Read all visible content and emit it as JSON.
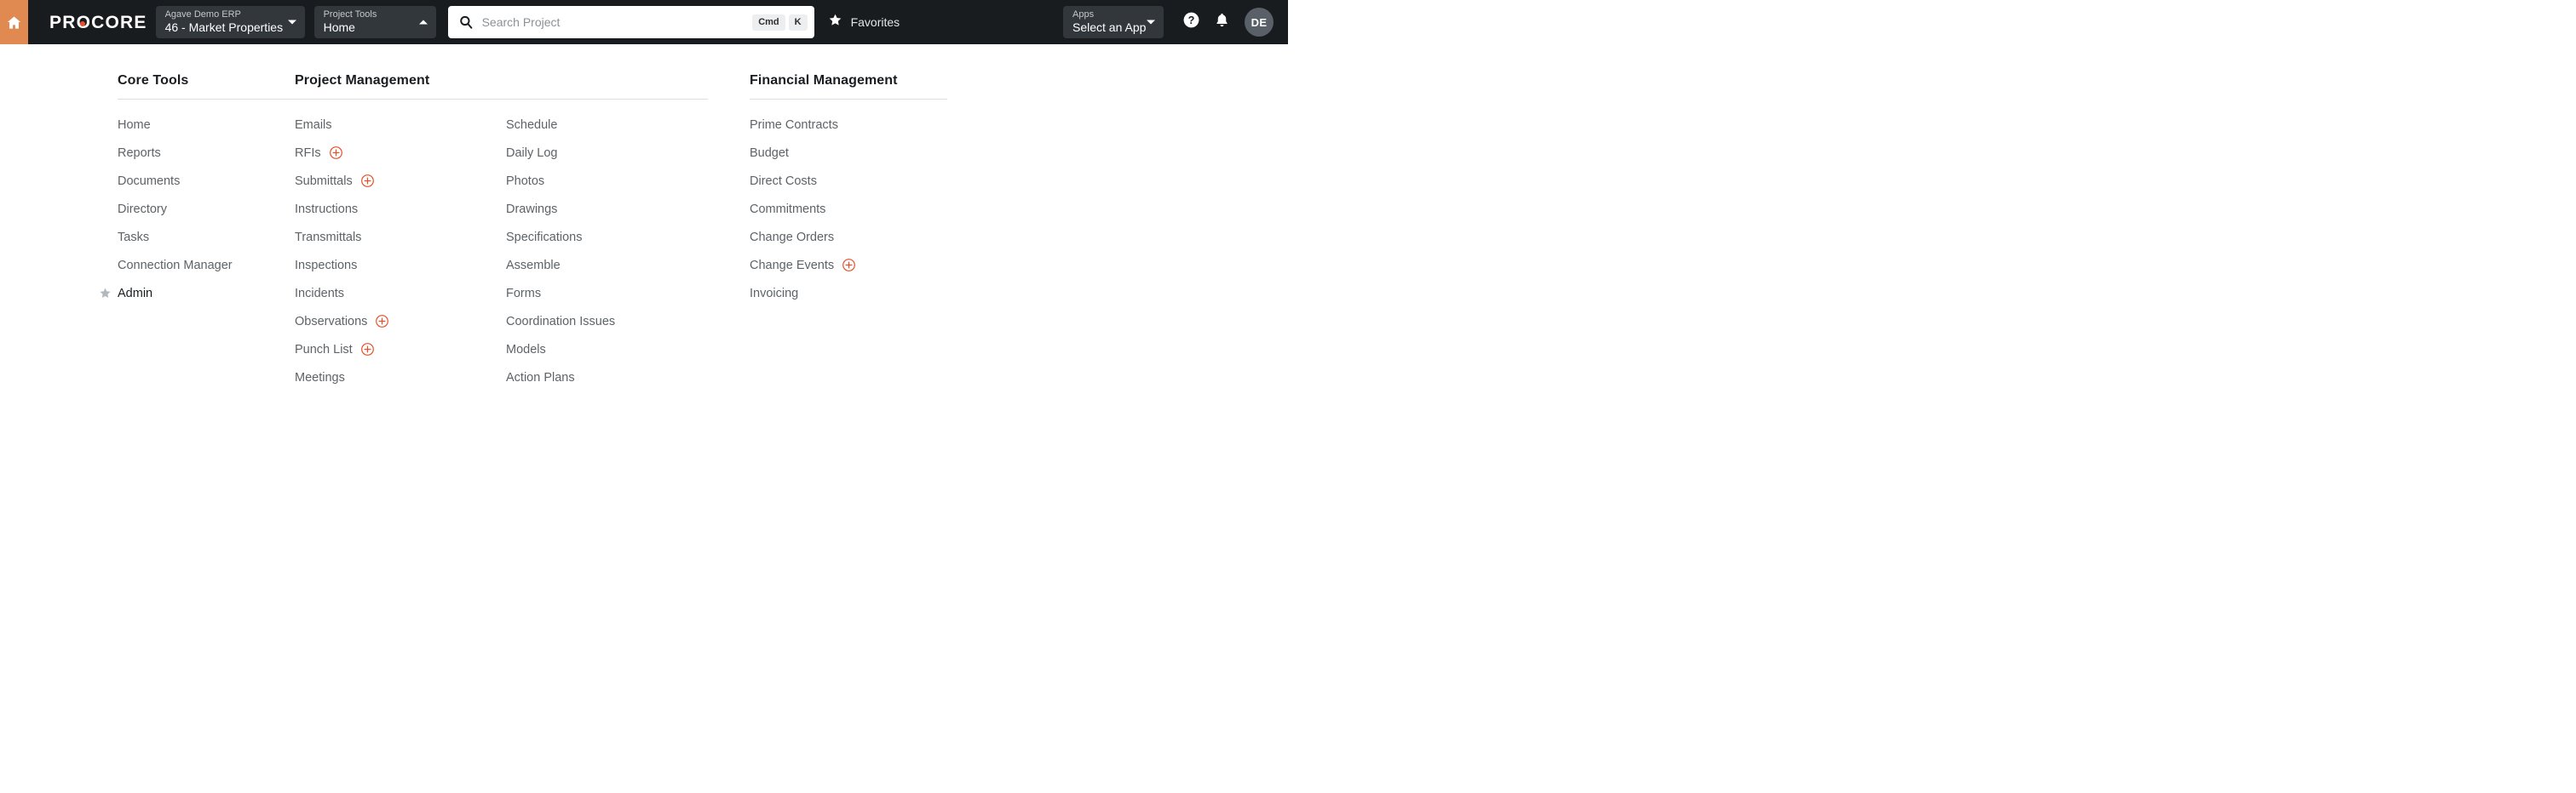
{
  "colors": {
    "header_bg": "#191C1F",
    "home_orange": "#E08A52",
    "accent_orange": "#E8502A",
    "select_bg": "#32373C",
    "text_muted": "#5E6367",
    "text_dark": "#1A1D20"
  },
  "header": {
    "home_icon": "home-icon",
    "brand": "PROCORE",
    "project_select": {
      "label": "Agave Demo ERP",
      "value": "46 - Market Properties",
      "caret": "chevron-down-icon"
    },
    "tools_select": {
      "label": "Project Tools",
      "value": "Home",
      "caret": "chevron-up-icon"
    },
    "search": {
      "icon": "search-icon",
      "placeholder": "Search Project",
      "value": "",
      "shortcut_modifier": "Cmd",
      "shortcut_key": "K"
    },
    "favorites": {
      "icon": "star-icon",
      "label": "Favorites"
    },
    "apps_select": {
      "label": "Apps",
      "value": "Select an App",
      "caret": "chevron-down-icon"
    },
    "help_icon": "help-circle-icon",
    "notifications_icon": "bell-icon",
    "avatar_initials": "DE"
  },
  "menu": {
    "groups": [
      {
        "title": "Core Tools",
        "columns": [
          {
            "items": [
              {
                "label": "Home"
              },
              {
                "label": "Reports"
              },
              {
                "label": "Documents"
              },
              {
                "label": "Directory"
              },
              {
                "label": "Tasks"
              },
              {
                "label": "Connection Manager"
              },
              {
                "label": "Admin",
                "starred": true,
                "accented": true
              }
            ]
          }
        ]
      },
      {
        "title": "Project Management",
        "columns": [
          {
            "items": [
              {
                "label": "Emails"
              },
              {
                "label": "RFIs",
                "add": true
              },
              {
                "label": "Submittals",
                "add": true
              },
              {
                "label": "Instructions"
              },
              {
                "label": "Transmittals"
              },
              {
                "label": "Inspections"
              },
              {
                "label": "Incidents"
              },
              {
                "label": "Observations",
                "add": true
              },
              {
                "label": "Punch List",
                "add": true
              },
              {
                "label": "Meetings"
              }
            ]
          },
          {
            "items": [
              {
                "label": "Schedule"
              },
              {
                "label": "Daily Log"
              },
              {
                "label": "Photos"
              },
              {
                "label": "Drawings"
              },
              {
                "label": "Specifications"
              },
              {
                "label": "Assemble"
              },
              {
                "label": "Forms"
              },
              {
                "label": "Coordination Issues"
              },
              {
                "label": "Models"
              },
              {
                "label": "Action Plans"
              }
            ]
          }
        ]
      },
      {
        "title": "Financial Management",
        "columns": [
          {
            "items": [
              {
                "label": "Prime Contracts"
              },
              {
                "label": "Budget"
              },
              {
                "label": "Direct Costs"
              },
              {
                "label": "Commitments"
              },
              {
                "label": "Change Orders"
              },
              {
                "label": "Change Events",
                "add": true
              },
              {
                "label": "Invoicing"
              }
            ]
          }
        ]
      }
    ]
  }
}
